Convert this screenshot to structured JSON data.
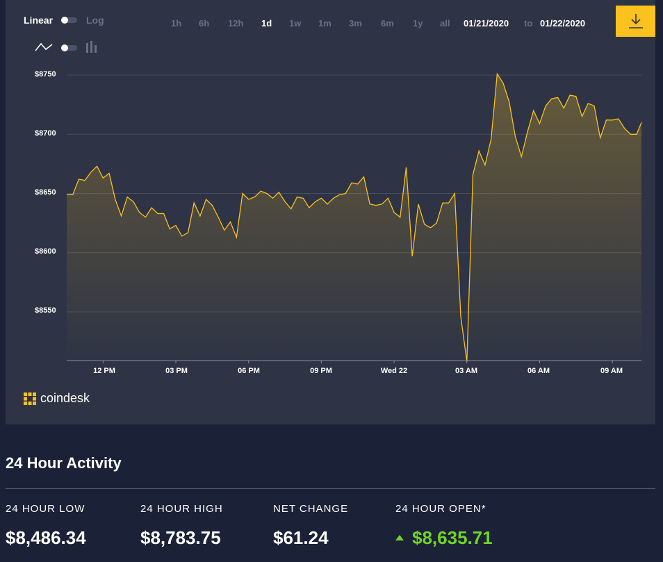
{
  "scale_toggle": {
    "left_label": "Linear",
    "right_label": "Log",
    "selected": "Linear"
  },
  "chart_style_toggle": {
    "left_icon": "line-chart-icon",
    "right_icon": "bar-chart-icon",
    "selected": "line"
  },
  "ranges": [
    {
      "label": "1h",
      "active": false
    },
    {
      "label": "6h",
      "active": false
    },
    {
      "label": "12h",
      "active": false
    },
    {
      "label": "1d",
      "active": true
    },
    {
      "label": "1w",
      "active": false
    },
    {
      "label": "1m",
      "active": false
    },
    {
      "label": "3m",
      "active": false
    },
    {
      "label": "6m",
      "active": false
    },
    {
      "label": "1y",
      "active": false
    },
    {
      "label": "all",
      "active": false
    }
  ],
  "date_range": {
    "from": "01/21/2020",
    "to_label": "to",
    "to": "01/22/2020"
  },
  "download": {
    "icon": "download-icon",
    "color": "#fbc11c"
  },
  "brand": {
    "name": "coindesk",
    "icon": "coindesk-logo-icon"
  },
  "chart_data": {
    "type": "area",
    "line_color": "#fbc11c",
    "y_ticks": [
      "$8750",
      "$8700",
      "$8650",
      "$8600",
      "$8550"
    ],
    "y_tick_values": [
      8750,
      8700,
      8650,
      8600,
      8550
    ],
    "ylim": [
      8510,
      8760
    ],
    "x_ticks": [
      "12 PM",
      "03 PM",
      "06 PM",
      "09 PM",
      "Wed 22",
      "03 AM",
      "06 AM",
      "09 AM"
    ],
    "x_tick_hours": [
      12,
      15,
      18,
      21,
      24,
      27,
      30,
      33
    ],
    "xlim": [
      10.5,
      34.2
    ],
    "grid": true,
    "series": [
      {
        "x": [
          10.5,
          10.75,
          11,
          11.25,
          11.5,
          11.75,
          12,
          12.25,
          12.5,
          12.75,
          13,
          13.25,
          13.5,
          13.75,
          14,
          14.25,
          14.5,
          14.75,
          15,
          15.25,
          15.5,
          15.75,
          16,
          16.25,
          16.5,
          16.75,
          17,
          17.25,
          17.5,
          17.75,
          18,
          18.25,
          18.5,
          18.75,
          19,
          19.25,
          19.5,
          19.75,
          20,
          20.25,
          20.5,
          20.75,
          21,
          21.25,
          21.5,
          21.75,
          22,
          22.25,
          22.5,
          22.75,
          23,
          23.25,
          23.5,
          23.75,
          24,
          24.25,
          24.5,
          24.75,
          25,
          25.25,
          25.5,
          25.75,
          26,
          26.25,
          26.5,
          26.75,
          27,
          27.25,
          27.5,
          27.75,
          28,
          28.25,
          28.5,
          28.75,
          29,
          29.25,
          29.5,
          29.75,
          30,
          30.25,
          30.5,
          30.75,
          31,
          31.25,
          31.5,
          31.75,
          32,
          32.25,
          32.5,
          32.75,
          33,
          33.25,
          33.5,
          33.75,
          34,
          34.2
        ],
        "y": [
          8649,
          8649,
          8662,
          8661,
          8668,
          8673,
          8663,
          8667,
          8645,
          8631,
          8647,
          8643,
          8634,
          8630,
          8638,
          8633,
          8633,
          8620,
          8623,
          8614,
          8617,
          8642,
          8631,
          8645,
          8640,
          8630,
          8619,
          8626,
          8613,
          8650,
          8645,
          8647,
          8652,
          8650,
          8646,
          8651,
          8643,
          8637,
          8647,
          8646,
          8638,
          8643,
          8646,
          8641,
          8646,
          8649,
          8650,
          8659,
          8658,
          8664,
          8641,
          8640,
          8641,
          8646,
          8634,
          8630,
          8672,
          8597,
          8641,
          8624,
          8621,
          8625,
          8642,
          8642,
          8650,
          8546,
          8508,
          8666,
          8686,
          8674,
          8696,
          8751,
          8743,
          8727,
          8698,
          8681,
          8702,
          8720,
          8709,
          8724,
          8730,
          8731,
          8722,
          8733,
          8732,
          8715,
          8726,
          8724,
          8697,
          8712,
          8712,
          8713,
          8705,
          8700,
          8700,
          8710
        ]
      }
    ]
  },
  "activity": {
    "title": "24 Hour Activity",
    "stats": [
      {
        "label": "24 HOUR LOW",
        "value": "$8,486.34",
        "trend": ""
      },
      {
        "label": "24 HOUR HIGH",
        "value": "$8,783.75",
        "trend": ""
      },
      {
        "label": "NET CHANGE",
        "value": "$61.24",
        "trend": ""
      },
      {
        "label": "24 HOUR OPEN*",
        "value": "$8,635.71",
        "trend": "up"
      }
    ]
  }
}
